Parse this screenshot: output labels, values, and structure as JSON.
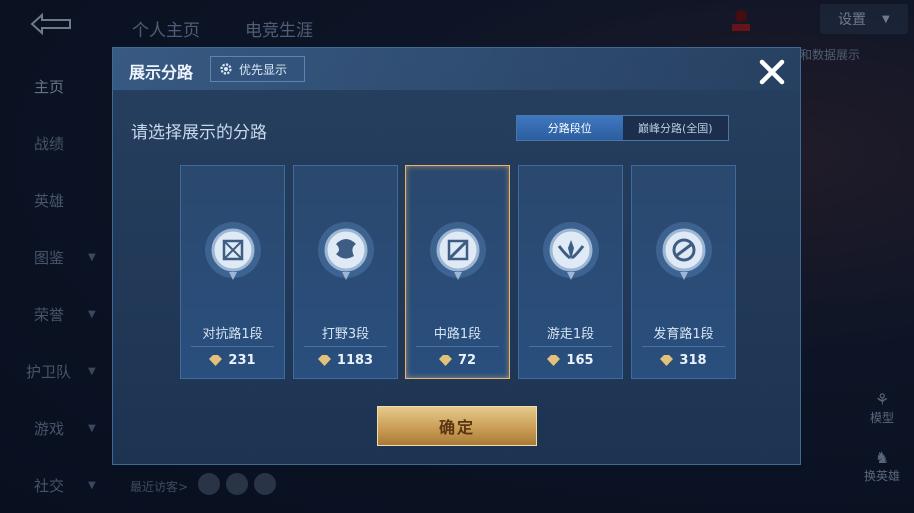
{
  "header": {
    "tabs": [
      "个人主页",
      "电竞生涯"
    ],
    "settings_label": "设置"
  },
  "sidebar": {
    "items": [
      {
        "label": "主页"
      },
      {
        "label": "战绩"
      },
      {
        "label": "英雄"
      },
      {
        "label": "图鉴"
      },
      {
        "label": "荣誉"
      },
      {
        "label": "护卫队"
      },
      {
        "label": "游戏"
      },
      {
        "label": "社交"
      }
    ]
  },
  "footer": {
    "recent_visitors_label": "最近访客>"
  },
  "right_tools": {
    "model_label": "模型",
    "change_hero_label": "换英雄"
  },
  "bg_hint": "和数据展示",
  "modal": {
    "title": "展示分路",
    "priority_label": "优先显示",
    "prompt": "请选择展示的分路",
    "toggle": {
      "options": [
        "分路段位",
        "巅峰分路(全国)"
      ],
      "selected": "分路段位"
    },
    "cards": [
      {
        "lane": "对抗路1段",
        "points": "231",
        "icon": "top-lane-emblem-icon",
        "selected": false
      },
      {
        "lane": "打野3段",
        "points": "1183",
        "icon": "jungle-emblem-icon",
        "selected": false
      },
      {
        "lane": "中路1段",
        "points": "72",
        "icon": "mid-lane-emblem-icon",
        "selected": true
      },
      {
        "lane": "游走1段",
        "points": "165",
        "icon": "roam-emblem-icon",
        "selected": false
      },
      {
        "lane": "发育路1段",
        "points": "318",
        "icon": "adc-lane-emblem-icon",
        "selected": false
      }
    ],
    "confirm_label": "确定"
  },
  "colors": {
    "accent_gold": "#e9b46c",
    "toggle_active": "#3f78c0",
    "modal_bg": "#27405f"
  }
}
